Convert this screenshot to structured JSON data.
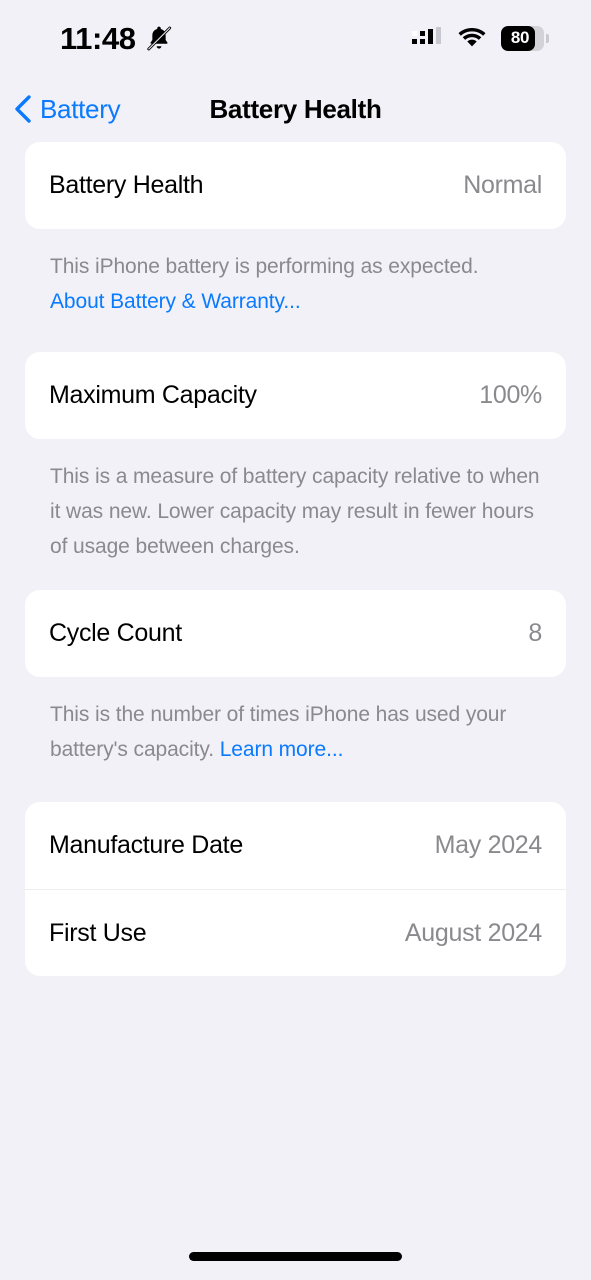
{
  "status_bar": {
    "time": "11:48",
    "silent_icon": "bell-slash-icon",
    "cellular_icon": "cellular-signal-icon",
    "wifi_icon": "wifi-icon",
    "battery_percent_label": "80",
    "battery_level": 80
  },
  "nav": {
    "back_label": "Battery",
    "back_icon": "chevron-left-icon",
    "title": "Battery Health"
  },
  "sections": {
    "health": {
      "row_label": "Battery Health",
      "row_value": "Normal",
      "footnote_text": "This iPhone battery is performing as expected.",
      "footnote_link": "About Battery & Warranty..."
    },
    "capacity": {
      "row_label": "Maximum Capacity",
      "row_value": "100%",
      "footnote_text": "This is a measure of battery capacity relative to when it was new. Lower capacity may result in fewer hours of usage between charges."
    },
    "cycles": {
      "row_label": "Cycle Count",
      "row_value": "8",
      "footnote_text": "This is the number of times iPhone has used your battery's capacity.",
      "footnote_link": "Learn more..."
    },
    "dates": {
      "rows": [
        {
          "label": "Manufacture Date",
          "value": "May 2024"
        },
        {
          "label": "First Use",
          "value": "August 2024"
        }
      ]
    }
  },
  "colors": {
    "background": "#F1F1F7",
    "card": "#FFFFFF",
    "accent_blue": "#0A7AFF",
    "secondary_text": "#8A8A8E",
    "primary_text": "#000000"
  }
}
